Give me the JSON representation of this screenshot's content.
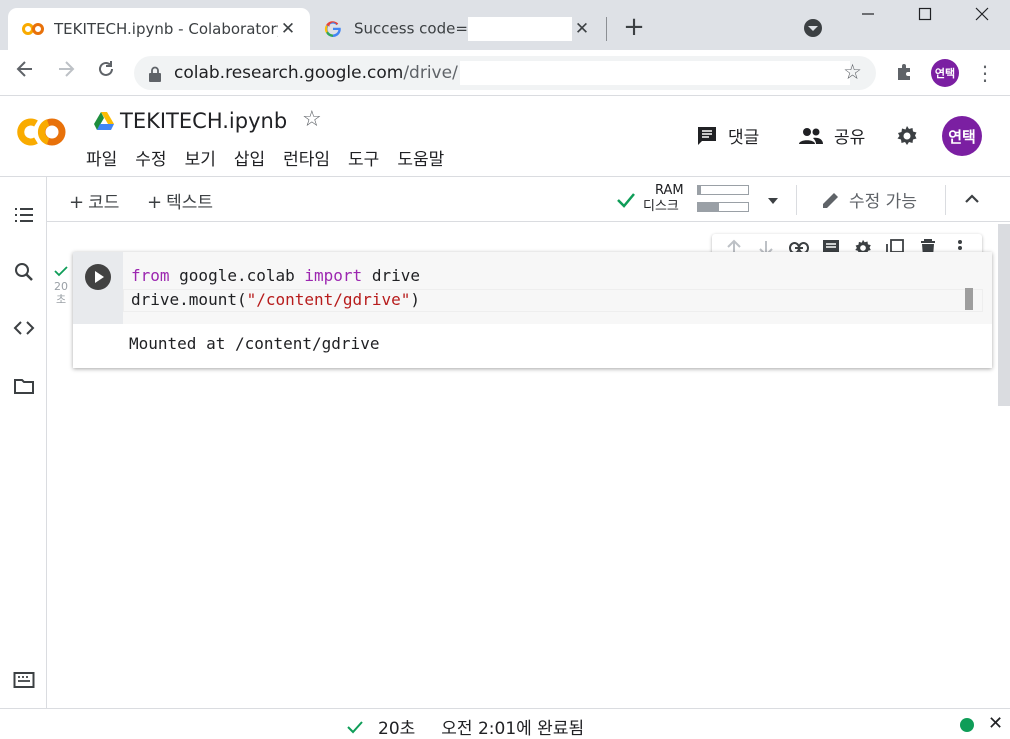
{
  "browser": {
    "tabs": [
      {
        "title": "TEKITECH.ipynb - Colaboratory",
        "close": "✕"
      },
      {
        "title": "Success code=",
        "close": "✕"
      }
    ],
    "new_tab": "+",
    "window": {
      "minimize": "—",
      "maximize": "☐",
      "close": "✕"
    },
    "url_host": "colab.research.google.com",
    "url_path": "/drive/",
    "profile_initials": "연택"
  },
  "colab": {
    "notebook_title": "TEKITECH.ipynb",
    "menu": [
      "파일",
      "수정",
      "보기",
      "삽입",
      "런타임",
      "도구",
      "도움말"
    ],
    "comment_label": "댓글",
    "share_label": "공유",
    "avatar_initials": "연택"
  },
  "toolbar": {
    "add_code": "코드",
    "add_text": "텍스트",
    "ram_label": "RAM",
    "disk_label": "디스크",
    "ram_usage": 0.06,
    "disk_usage": 0.42,
    "edit_mode": "수정 가능"
  },
  "cell": {
    "exec_time": "20",
    "exec_unit": "초",
    "code_line1": {
      "kw1": "from",
      "mod": " google.colab ",
      "kw2": "import",
      "name": " drive"
    },
    "code_line2": {
      "pre": "drive.mount(",
      "str": "\"/content/gdrive\"",
      "post": ")"
    },
    "output": "Mounted at /content/gdrive"
  },
  "status": {
    "duration": "20초",
    "completed": "오전 2:01에 완료됨",
    "close": "✕"
  },
  "colors": {
    "accent_purple": "#7b1fa2",
    "keyword": "#9c27b0",
    "string": "#b71c1c",
    "success_green": "#0f9d58",
    "colab_orange": "#f9ab00"
  }
}
